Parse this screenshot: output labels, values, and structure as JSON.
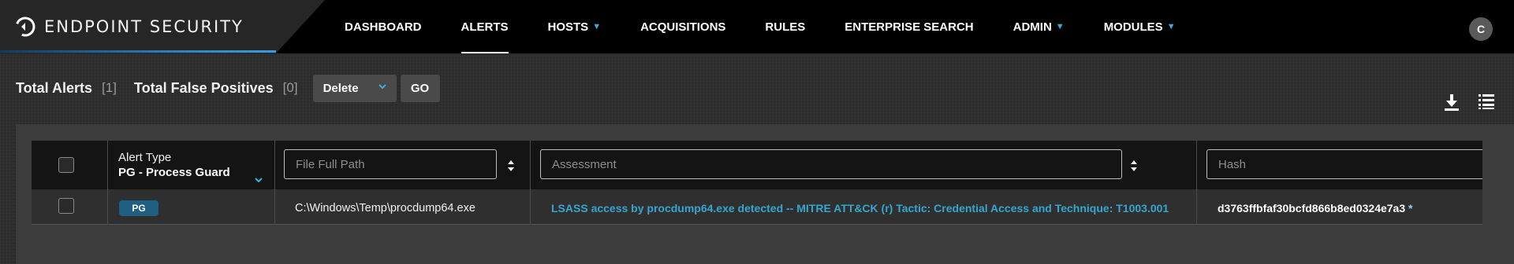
{
  "brand": {
    "name": "ENDPOINT SECURITY"
  },
  "nav": {
    "items": [
      {
        "label": "DASHBOARD",
        "has_menu": false,
        "active": false
      },
      {
        "label": "ALERTS",
        "has_menu": false,
        "active": true
      },
      {
        "label": "HOSTS",
        "has_menu": true,
        "active": false
      },
      {
        "label": "ACQUISITIONS",
        "has_menu": false,
        "active": false
      },
      {
        "label": "RULES",
        "has_menu": false,
        "active": false
      },
      {
        "label": "ENTERPRISE SEARCH",
        "has_menu": false,
        "active": false
      },
      {
        "label": "ADMIN",
        "has_menu": true,
        "active": false
      },
      {
        "label": "MODULES",
        "has_menu": true,
        "active": false
      }
    ],
    "chevron_icon": "chevron-down-icon"
  },
  "user": {
    "initial": "C"
  },
  "summary": {
    "total_alerts_label": "Total Alerts",
    "total_alerts_count": "[1]",
    "false_positives_label": "Total False Positives",
    "false_positives_count": "[0]",
    "action_selected": "Delete",
    "go_label": "GO"
  },
  "toolbar_icons": [
    "download-icon",
    "list-icon"
  ],
  "table": {
    "columns": {
      "alert_type": {
        "title": "Alert Type",
        "filter_value": "PG - Process Guard"
      },
      "file_path": {
        "placeholder": "File Full Path"
      },
      "assessment": {
        "placeholder": "Assessment"
      },
      "hash": {
        "placeholder": "Hash"
      }
    },
    "rows": [
      {
        "badge": "PG",
        "file_path": "C:\\Windows\\Temp\\procdump64.exe",
        "assessment": "LSASS access by procdump64.exe detected -- MITRE ATT&CK (r) Tactic: Credential Access and Technique: T1003.001",
        "hash": "d3763ffbfaf30bcfd866b8ed0324e7a3",
        "hash_marker": "*"
      }
    ]
  },
  "colors": {
    "accent": "#3ab0d8",
    "badge": "#1f5f82",
    "assessment_link": "#35a6cf",
    "header_bg": "#000000"
  }
}
